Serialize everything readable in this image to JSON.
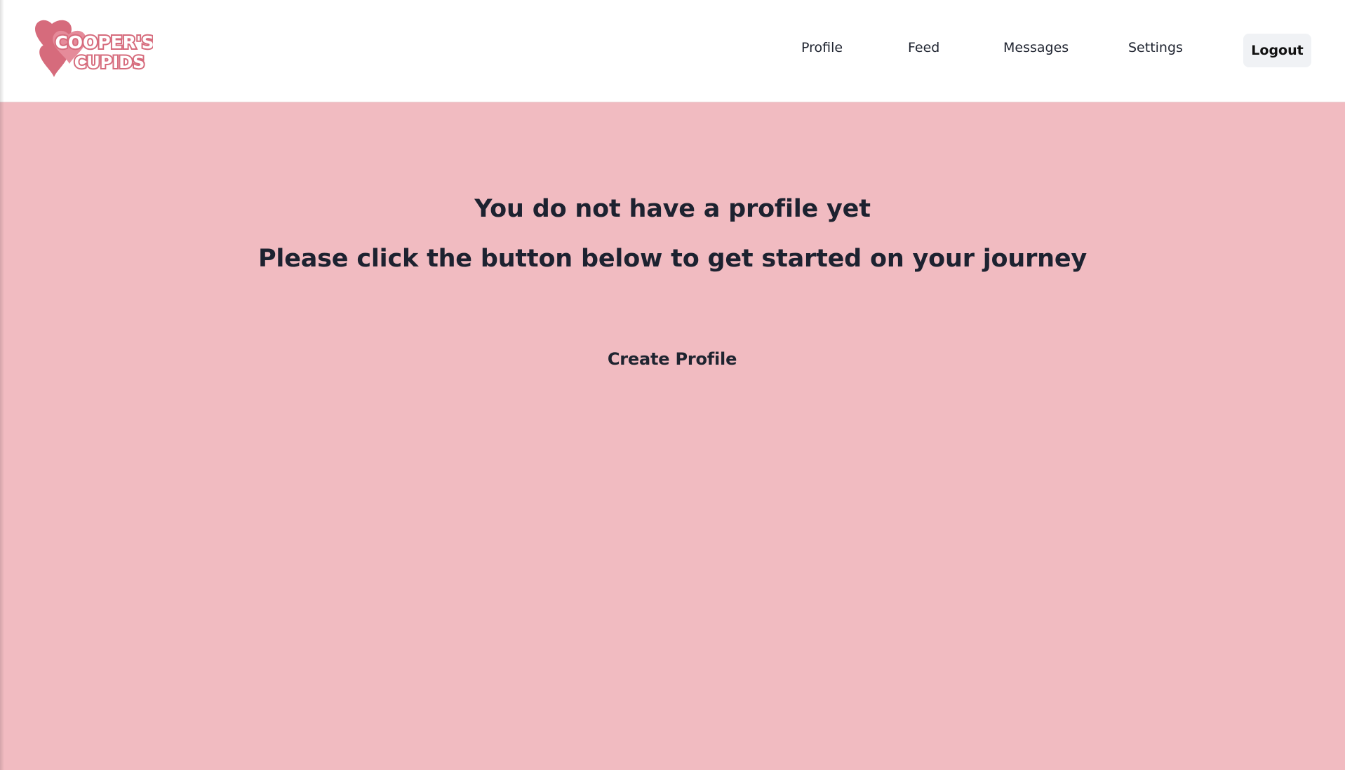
{
  "brand": {
    "logo_text_line1": "COOPER'S",
    "logo_text_line2": "CUPIDS",
    "colors": {
      "logo_heart": "#d66b7c",
      "logo_text_fill": "#ffffff",
      "logo_outline": "#d66b7c"
    }
  },
  "nav": {
    "links": [
      {
        "label": "Profile"
      },
      {
        "label": "Feed"
      },
      {
        "label": "Messages"
      },
      {
        "label": "Settings"
      }
    ],
    "logout_label": "Logout"
  },
  "main": {
    "message_line1": "You do not have a profile yet",
    "message_line2": "Please click the button below to get started on your journey",
    "create_button_label": "Create Profile"
  },
  "theme": {
    "page_bg": "#f1bbc1",
    "header_bg": "#ffffff",
    "text_color": "#1d2230",
    "logout_bg": "#f0f2f5"
  }
}
